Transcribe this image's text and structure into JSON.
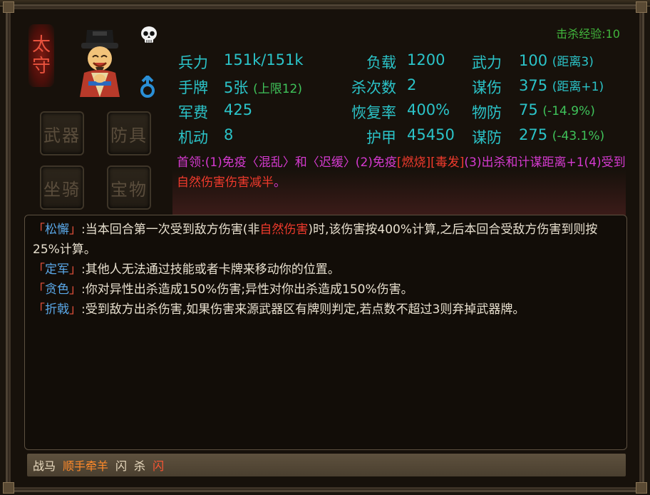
{
  "role": {
    "char1": "太",
    "char2": "守"
  },
  "equip_slots": [
    {
      "label": "武器"
    },
    {
      "label": "防具"
    },
    {
      "label": "坐骑"
    },
    {
      "label": "宝物"
    }
  ],
  "kill_exp": "击杀经验:10",
  "stats": {
    "troops": {
      "label": "兵力",
      "value": "151k/151k"
    },
    "hand": {
      "label": "手牌",
      "value": "5张",
      "note": "(上限12)"
    },
    "funds": {
      "label": "军费",
      "value": "425"
    },
    "mobility": {
      "label": "机动",
      "value": "8"
    },
    "load": {
      "label": "负载",
      "value": "1200"
    },
    "kills": {
      "label": "杀次数",
      "value": "2"
    },
    "recovery": {
      "label": "恢复率",
      "value": "400%"
    },
    "armor": {
      "label": "护甲",
      "value": "45450"
    },
    "force": {
      "label": "武力",
      "value": "100",
      "note": "(距离3)"
    },
    "strategy_dmg": {
      "label": "谋伤",
      "value": "375",
      "note": "(距离+1)"
    },
    "phys_def": {
      "label": "物防",
      "value": "75",
      "note": "(-14.9%)"
    },
    "strategy_def": {
      "label": "谋防",
      "value": "275",
      "note": "(-43.1%)"
    }
  },
  "leader": {
    "p1": "首领:(1)免疫〈混乱〉和〈迟缓〉(2)免疫",
    "p2": "[燃烧][毒发]",
    "p3": "(3)出杀和计谋距离+1(4)受到",
    "p4": "自然伤害伤害减半",
    "p5": "。"
  },
  "skills": [
    {
      "open": "「",
      "name": "松懈",
      "close": "」",
      "text_a": ":当本回合第一次受到敌方伤害(非",
      "text_red": "自然伤害",
      "text_b": ")时,该伤害按400%计算,之后本回合受敌方伤害到则按25%计算。"
    },
    {
      "open": "「",
      "name": "定军",
      "close": "」",
      "text": ":其他人无法通过技能或者卡牌来移动你的位置。"
    },
    {
      "open": "「",
      "name": "贪色",
      "close": "」",
      "text": ":你对异性出杀造成150%伤害;异性对你出杀造成150%伤害。"
    },
    {
      "open": "「",
      "name": "折戟",
      "close": "」",
      "text": ":受到敌方出杀伤害,如果伤害来源武器区有牌则判定,若点数不超过3则弃掉武器牌。"
    }
  ],
  "bottom_bar": {
    "item1": "战马",
    "item2": "顺手牵羊",
    "item3": "闪",
    "item4": "杀",
    "item5": "闪"
  }
}
